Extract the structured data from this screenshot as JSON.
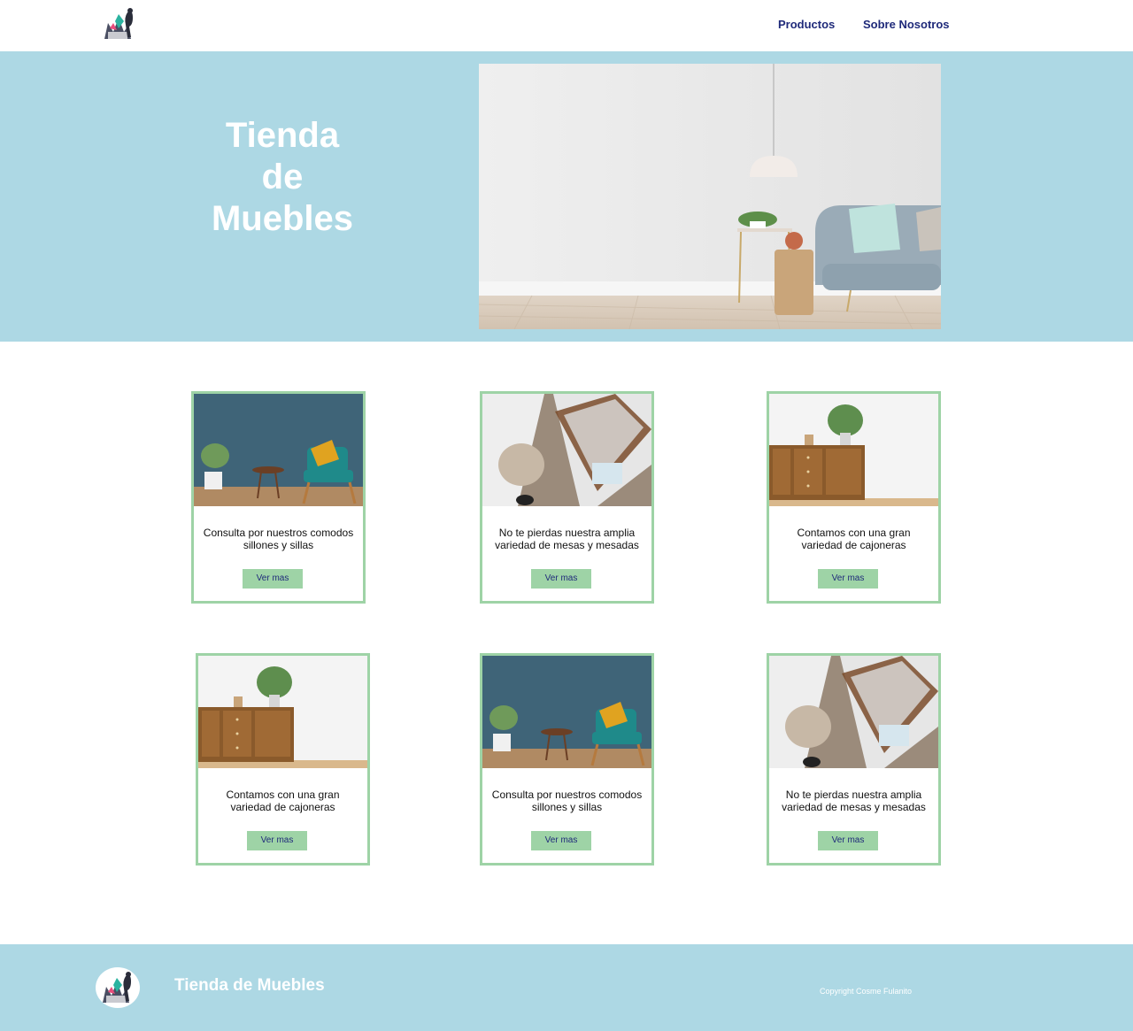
{
  "header": {
    "logo_icon": "furniture-store-logo-icon",
    "nav": [
      {
        "label": "Productos"
      },
      {
        "label": "Sobre Nosotros"
      }
    ]
  },
  "hero": {
    "title_lines": [
      "Tienda",
      "de",
      "Muebles"
    ],
    "image_icon": "living-room-photo"
  },
  "cards": [
    {
      "text": "Consulta por nuestros comodos sillones y sillas",
      "button": "Ver mas",
      "image": "armchair-photo"
    },
    {
      "text": "No te pierdas nuestra amplia variedad de mesas y mesadas",
      "button": "Ver mas",
      "image": "side-table-photo"
    },
    {
      "text": "Contamos con una gran variedad de cajoneras",
      "button": "Ver mas",
      "image": "dresser-photo"
    },
    {
      "text": "Contamos con una gran variedad de cajoneras",
      "button": "Ver mas",
      "image": "dresser-photo"
    },
    {
      "text": "Consulta por nuestros comodos sillones y sillas",
      "button": "Ver mas",
      "image": "armchair-photo"
    },
    {
      "text": "No te pierdas nuestra amplia variedad de mesas y mesadas",
      "button": "Ver mas",
      "image": "side-table-photo"
    }
  ],
  "footer": {
    "title": "Tienda de Muebles",
    "copyright": "Copyright Cosme Fulanito"
  },
  "colors": {
    "accent_blue": "#add8e4",
    "nav_text": "#1f2a7a",
    "card_border": "#9ed3a6"
  }
}
